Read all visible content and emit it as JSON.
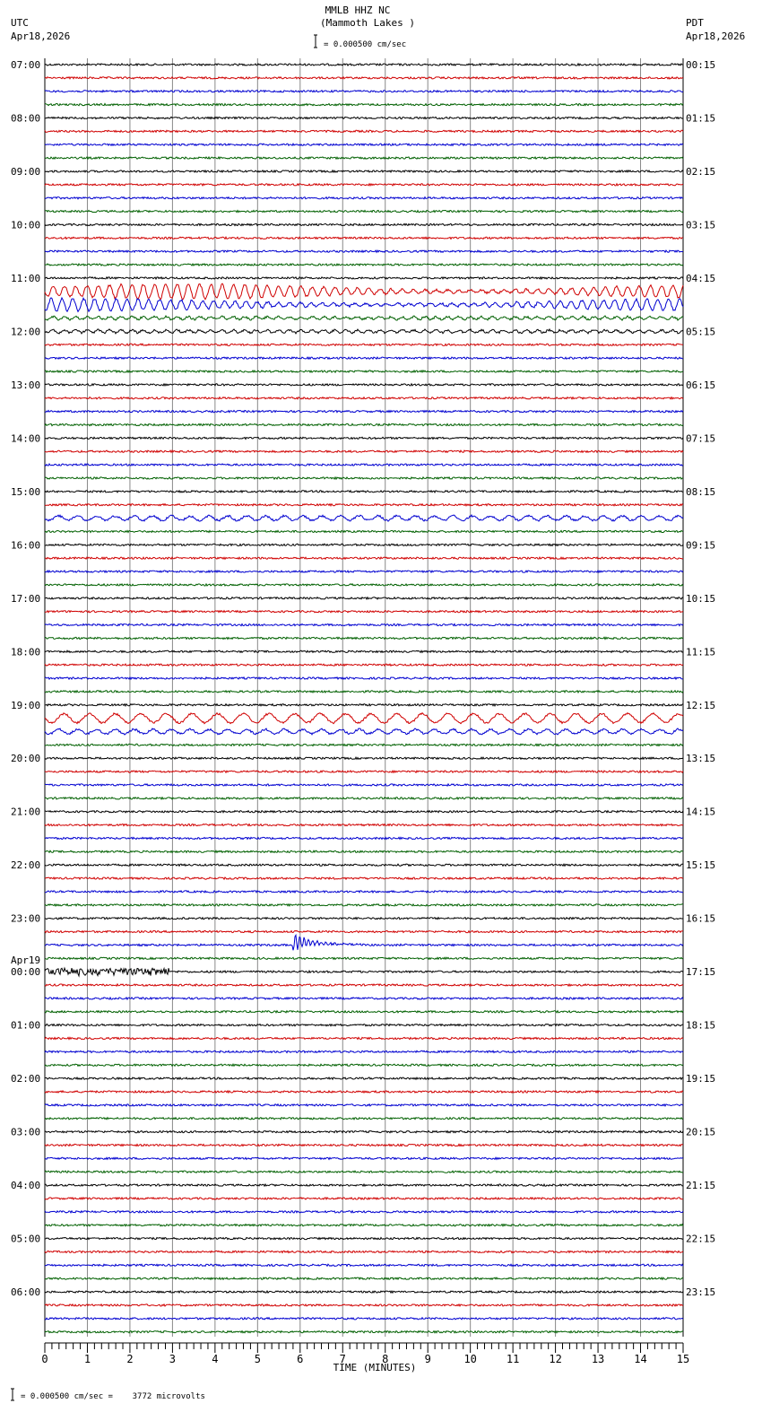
{
  "chart_data": {
    "type": "line",
    "title": "MMLB HHZ NC",
    "subtitle": "(Mammoth Lakes )",
    "scale_label": "= 0.000500 cm/sec",
    "left_timezone": "UTC",
    "left_date": "Apr18,2026",
    "right_timezone": "PDT",
    "right_date": "Apr18,2026",
    "date_change_label": "Apr19",
    "left_hour_labels": [
      "07:00",
      "08:00",
      "09:00",
      "10:00",
      "11:00",
      "12:00",
      "13:00",
      "14:00",
      "15:00",
      "16:00",
      "17:00",
      "18:00",
      "19:00",
      "20:00",
      "21:00",
      "22:00",
      "23:00",
      "00:00",
      "01:00",
      "02:00",
      "03:00",
      "04:00",
      "05:00",
      "06:00"
    ],
    "right_hour_labels": [
      "00:15",
      "01:15",
      "02:15",
      "03:15",
      "04:15",
      "05:15",
      "06:15",
      "07:15",
      "08:15",
      "09:15",
      "10:15",
      "11:15",
      "12:15",
      "13:15",
      "14:15",
      "15:15",
      "16:15",
      "17:15",
      "18:15",
      "19:15",
      "20:15",
      "21:15",
      "22:15",
      "23:15"
    ],
    "traces_per_hour": 4,
    "trace_colors": [
      "#000000",
      "#d00000",
      "#0000d0",
      "#006000"
    ],
    "xlabel": "TIME (MINUTES)",
    "x_ticks": [
      "0",
      "1",
      "2",
      "3",
      "4",
      "5",
      "6",
      "7",
      "8",
      "9",
      "10",
      "11",
      "12",
      "13",
      "14",
      "15"
    ],
    "xlim": [
      0,
      15
    ],
    "footer": "= 0.000500 cm/sec =    3772 microvolts",
    "grid": true
  }
}
